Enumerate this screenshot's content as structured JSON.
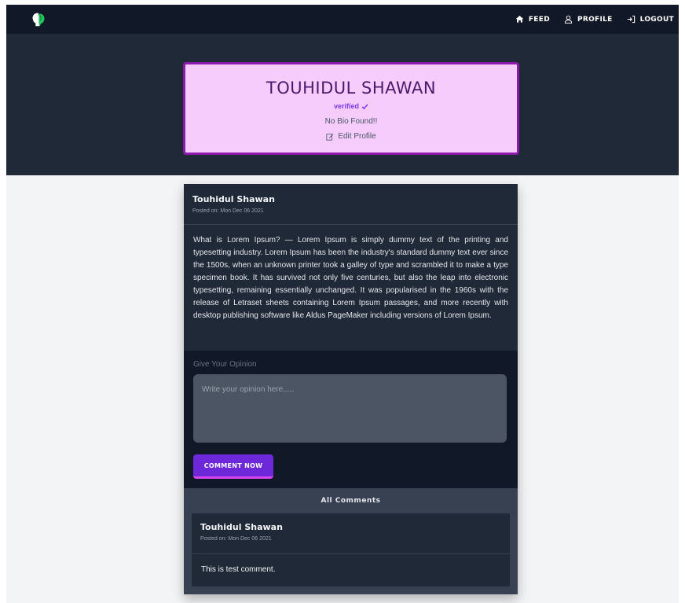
{
  "nav": {
    "links": [
      {
        "label": "FEED",
        "icon": "home-icon"
      },
      {
        "label": "PROFILE",
        "icon": "user-icon"
      },
      {
        "label": "LOGOUT",
        "icon": "logout-icon"
      }
    ]
  },
  "profile": {
    "name": "TOUHIDUL SHAWAN",
    "verified_label": "verified",
    "bio": "No Bio Found!!",
    "edit_label": "Edit Profile"
  },
  "post": {
    "author": "Touhidul Shawan",
    "posted": "Posted on: Mon Dec 06 2021",
    "body": "What is Lorem Ipsum? — Lorem Ipsum is simply dummy text of the printing and typesetting industry. Lorem Ipsum has been the industry's standard dummy text ever since the 1500s, when an unknown printer took a galley of type and scrambled it to make a type specimen book. It has survived not only five centuries, but also the leap into electronic typesetting, remaining essentially unchanged. It was popularised in the 1960s with the release of Letraset sheets containing Lorem Ipsum passages, and more recently with desktop publishing software like Aldus PageMaker including versions of Lorem Ipsum."
  },
  "opinion": {
    "label": "Give Your Opinion",
    "placeholder": "Write your opinion here.....",
    "button_label": "COMMENT NOW"
  },
  "comments": {
    "title": "All Comments",
    "items": [
      {
        "author": "Touhidul Shawan",
        "posted": "Posted on: Mon Dec 06 2021",
        "text": "This is test comment."
      }
    ]
  },
  "colors": {
    "navbar": "#111827",
    "hero": "#1f2937",
    "card_bg": "#f5ccfc",
    "card_border": "#8b1aa8",
    "accent": "#6d28d9",
    "accent_underline": "#d946ef"
  }
}
